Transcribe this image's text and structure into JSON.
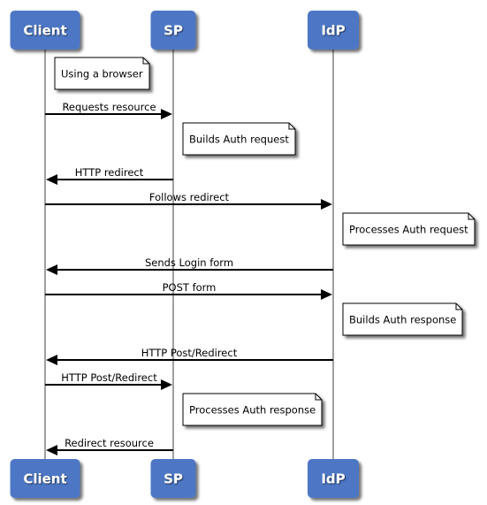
{
  "diagram": {
    "type": "sequence",
    "colors": {
      "actor_fill": "#4d77c4",
      "actor_text": "#ffffff",
      "lifeline": "#a0a0a0",
      "arrow": "#000000",
      "note_fill": "#ffffff",
      "note_border": "#000000"
    },
    "actors": [
      {
        "id": "client",
        "label": "Client"
      },
      {
        "id": "sp",
        "label": "SP"
      },
      {
        "id": "idp",
        "label": "IdP"
      }
    ],
    "steps": [
      {
        "kind": "note",
        "actor": "client",
        "text": "Using a browser"
      },
      {
        "kind": "message",
        "from": "client",
        "to": "sp",
        "text": "Requests resource"
      },
      {
        "kind": "note",
        "actor": "sp",
        "text": "Builds Auth request"
      },
      {
        "kind": "message",
        "from": "sp",
        "to": "client",
        "text": "HTTP redirect"
      },
      {
        "kind": "message",
        "from": "client",
        "to": "idp",
        "text": "Follows redirect"
      },
      {
        "kind": "note",
        "actor": "idp",
        "text": "Processes Auth request"
      },
      {
        "kind": "message",
        "from": "idp",
        "to": "client",
        "text": "Sends Login form"
      },
      {
        "kind": "message",
        "from": "client",
        "to": "idp",
        "text": "POST form"
      },
      {
        "kind": "note",
        "actor": "idp",
        "text": "Builds Auth response"
      },
      {
        "kind": "message",
        "from": "idp",
        "to": "client",
        "text": "HTTP Post/Redirect"
      },
      {
        "kind": "message",
        "from": "client",
        "to": "sp",
        "text": "HTTP Post/Redirect"
      },
      {
        "kind": "note",
        "actor": "sp",
        "text": "Processes Auth response"
      },
      {
        "kind": "message",
        "from": "sp",
        "to": "client",
        "text": "Redirect resource"
      }
    ]
  }
}
